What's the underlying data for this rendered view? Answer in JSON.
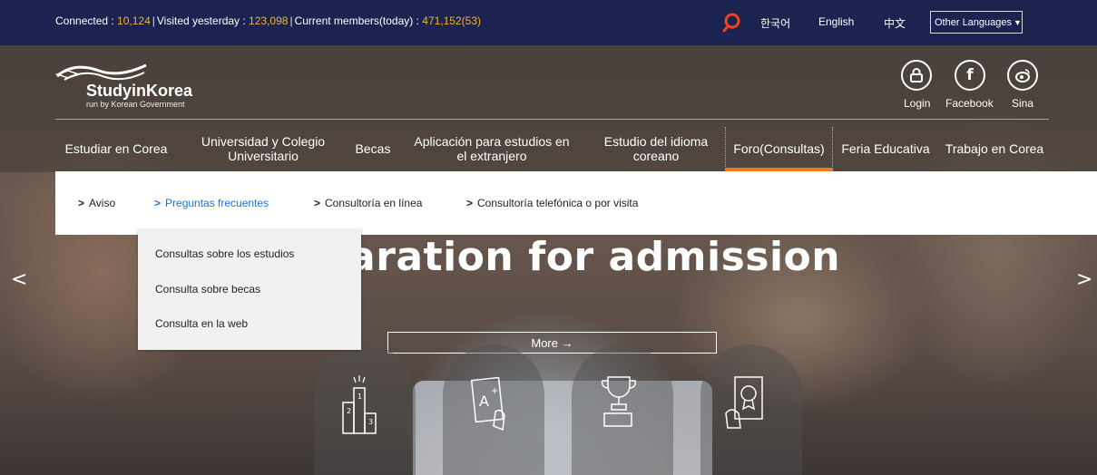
{
  "topbar": {
    "stats": {
      "connected_label": "Connected : ",
      "connected_value": "10,124",
      "visited_label": "Visited yesterday : ",
      "visited_value": "123,098",
      "members_label": "Current members(today) : ",
      "members_value": "471,152(53)"
    },
    "languages": [
      "한국어",
      "English",
      "中文"
    ],
    "lang_select": "Other Languages"
  },
  "logo": {
    "title": "StudyinKorea",
    "subtitle": "run by Korean Government"
  },
  "social": [
    {
      "label": "Login",
      "icon": "lock-icon"
    },
    {
      "label": "Facebook",
      "icon": "facebook-icon"
    },
    {
      "label": "Sina",
      "icon": "sina-weibo-icon"
    }
  ],
  "nav": [
    "Estudiar en Corea",
    "Universidad y Colegio Universitario",
    "Becas",
    "Aplicación para estudios en el extranjero",
    "Estudio del idioma coreano",
    "Foro(Consultas)",
    "Feria Educativa",
    "Trabajo en Corea"
  ],
  "subnav": [
    "Aviso",
    "Preguntas frecuentes",
    "Consultoría en línea",
    "Consultoría telefónica o por visita"
  ],
  "dropdown": [
    "Consultas sobre los estudios",
    "Consulta sobre becas",
    "Consulta en la web"
  ],
  "hero": {
    "headline": "aration for admission",
    "more_button": "More →"
  },
  "colors": {
    "topbar": "#1b2350",
    "accent_number": "#f2b233",
    "active_sub": "#1e73d8",
    "nav_underline": "#f07a1e"
  }
}
